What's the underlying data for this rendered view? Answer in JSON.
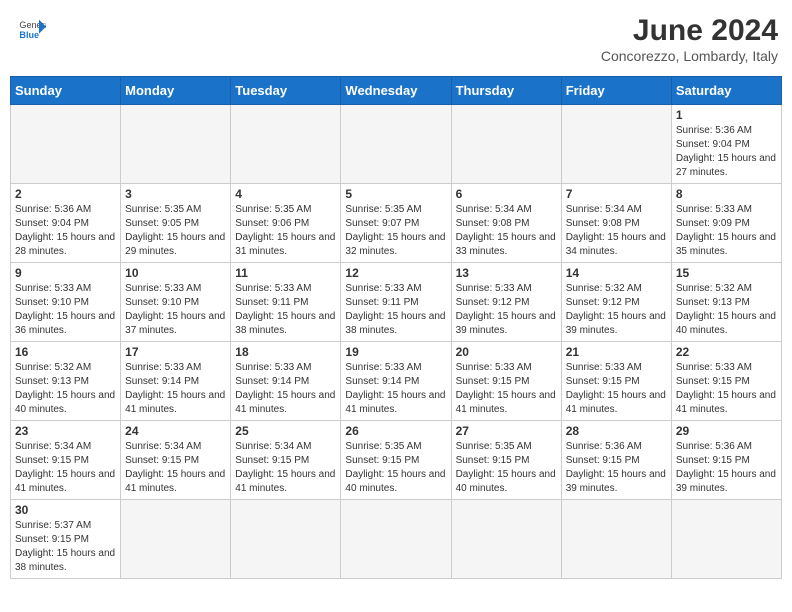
{
  "header": {
    "logo_general": "General",
    "logo_blue": "Blue",
    "month_title": "June 2024",
    "location": "Concorezzo, Lombardy, Italy"
  },
  "days_of_week": [
    "Sunday",
    "Monday",
    "Tuesday",
    "Wednesday",
    "Thursday",
    "Friday",
    "Saturday"
  ],
  "weeks": [
    [
      {
        "day": "",
        "info": ""
      },
      {
        "day": "",
        "info": ""
      },
      {
        "day": "",
        "info": ""
      },
      {
        "day": "",
        "info": ""
      },
      {
        "day": "",
        "info": ""
      },
      {
        "day": "",
        "info": ""
      },
      {
        "day": "1",
        "info": "Sunrise: 5:36 AM\nSunset: 9:04 PM\nDaylight: 15 hours and 27 minutes."
      }
    ],
    [
      {
        "day": "2",
        "info": "Sunrise: 5:36 AM\nSunset: 9:04 PM\nDaylight: 15 hours and 28 minutes."
      },
      {
        "day": "3",
        "info": "Sunrise: 5:35 AM\nSunset: 9:05 PM\nDaylight: 15 hours and 29 minutes."
      },
      {
        "day": "4",
        "info": "Sunrise: 5:35 AM\nSunset: 9:06 PM\nDaylight: 15 hours and 31 minutes."
      },
      {
        "day": "5",
        "info": "Sunrise: 5:35 AM\nSunset: 9:07 PM\nDaylight: 15 hours and 32 minutes."
      },
      {
        "day": "6",
        "info": "Sunrise: 5:34 AM\nSunset: 9:08 PM\nDaylight: 15 hours and 33 minutes."
      },
      {
        "day": "7",
        "info": "Sunrise: 5:34 AM\nSunset: 9:08 PM\nDaylight: 15 hours and 34 minutes."
      },
      {
        "day": "8",
        "info": "Sunrise: 5:33 AM\nSunset: 9:09 PM\nDaylight: 15 hours and 35 minutes."
      }
    ],
    [
      {
        "day": "9",
        "info": "Sunrise: 5:33 AM\nSunset: 9:10 PM\nDaylight: 15 hours and 36 minutes."
      },
      {
        "day": "10",
        "info": "Sunrise: 5:33 AM\nSunset: 9:10 PM\nDaylight: 15 hours and 37 minutes."
      },
      {
        "day": "11",
        "info": "Sunrise: 5:33 AM\nSunset: 9:11 PM\nDaylight: 15 hours and 38 minutes."
      },
      {
        "day": "12",
        "info": "Sunrise: 5:33 AM\nSunset: 9:11 PM\nDaylight: 15 hours and 38 minutes."
      },
      {
        "day": "13",
        "info": "Sunrise: 5:33 AM\nSunset: 9:12 PM\nDaylight: 15 hours and 39 minutes."
      },
      {
        "day": "14",
        "info": "Sunrise: 5:32 AM\nSunset: 9:12 PM\nDaylight: 15 hours and 39 minutes."
      },
      {
        "day": "15",
        "info": "Sunrise: 5:32 AM\nSunset: 9:13 PM\nDaylight: 15 hours and 40 minutes."
      }
    ],
    [
      {
        "day": "16",
        "info": "Sunrise: 5:32 AM\nSunset: 9:13 PM\nDaylight: 15 hours and 40 minutes."
      },
      {
        "day": "17",
        "info": "Sunrise: 5:33 AM\nSunset: 9:14 PM\nDaylight: 15 hours and 41 minutes."
      },
      {
        "day": "18",
        "info": "Sunrise: 5:33 AM\nSunset: 9:14 PM\nDaylight: 15 hours and 41 minutes."
      },
      {
        "day": "19",
        "info": "Sunrise: 5:33 AM\nSunset: 9:14 PM\nDaylight: 15 hours and 41 minutes."
      },
      {
        "day": "20",
        "info": "Sunrise: 5:33 AM\nSunset: 9:15 PM\nDaylight: 15 hours and 41 minutes."
      },
      {
        "day": "21",
        "info": "Sunrise: 5:33 AM\nSunset: 9:15 PM\nDaylight: 15 hours and 41 minutes."
      },
      {
        "day": "22",
        "info": "Sunrise: 5:33 AM\nSunset: 9:15 PM\nDaylight: 15 hours and 41 minutes."
      }
    ],
    [
      {
        "day": "23",
        "info": "Sunrise: 5:34 AM\nSunset: 9:15 PM\nDaylight: 15 hours and 41 minutes."
      },
      {
        "day": "24",
        "info": "Sunrise: 5:34 AM\nSunset: 9:15 PM\nDaylight: 15 hours and 41 minutes."
      },
      {
        "day": "25",
        "info": "Sunrise: 5:34 AM\nSunset: 9:15 PM\nDaylight: 15 hours and 41 minutes."
      },
      {
        "day": "26",
        "info": "Sunrise: 5:35 AM\nSunset: 9:15 PM\nDaylight: 15 hours and 40 minutes."
      },
      {
        "day": "27",
        "info": "Sunrise: 5:35 AM\nSunset: 9:15 PM\nDaylight: 15 hours and 40 minutes."
      },
      {
        "day": "28",
        "info": "Sunrise: 5:36 AM\nSunset: 9:15 PM\nDaylight: 15 hours and 39 minutes."
      },
      {
        "day": "29",
        "info": "Sunrise: 5:36 AM\nSunset: 9:15 PM\nDaylight: 15 hours and 39 minutes."
      }
    ],
    [
      {
        "day": "30",
        "info": "Sunrise: 5:37 AM\nSunset: 9:15 PM\nDaylight: 15 hours and 38 minutes."
      },
      {
        "day": "",
        "info": ""
      },
      {
        "day": "",
        "info": ""
      },
      {
        "day": "",
        "info": ""
      },
      {
        "day": "",
        "info": ""
      },
      {
        "day": "",
        "info": ""
      },
      {
        "day": "",
        "info": ""
      }
    ]
  ]
}
